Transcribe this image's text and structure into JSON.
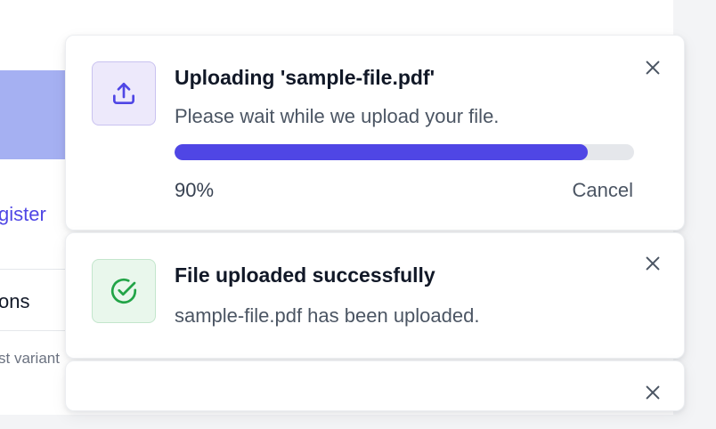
{
  "background": {
    "link_fragment": "gister",
    "row_fragment": "ons",
    "small_fragment": "st variant"
  },
  "upload_toast": {
    "title": "Uploading 'sample-file.pdf'",
    "message": "Please wait while we upload your file.",
    "progress_percent": 90,
    "progress_label": "90%",
    "cancel_label": "Cancel",
    "icon": "upload-icon",
    "accent_color": "#4f46e5"
  },
  "success_toast": {
    "title": "File uploaded successfully",
    "message": "sample-file.pdf has been uploaded.",
    "icon": "check-circle-icon",
    "accent_color": "#22a447"
  },
  "empty_toast": {
    "icon": "close-icon"
  }
}
